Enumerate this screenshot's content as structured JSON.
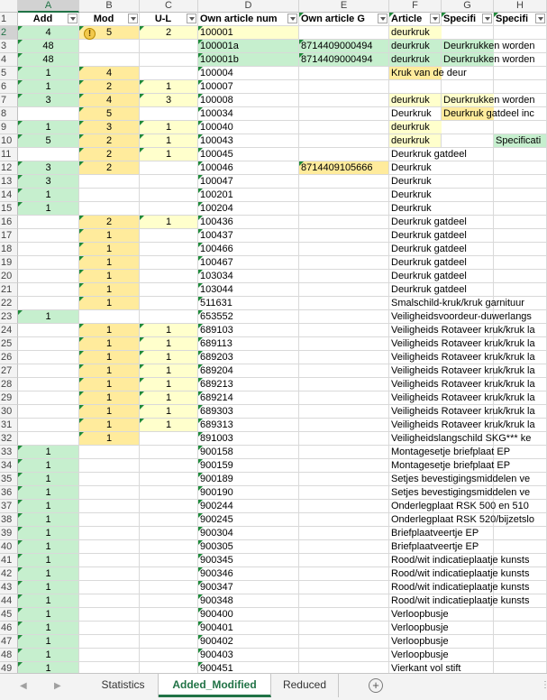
{
  "columns": [
    {
      "letter": "A",
      "header": "Add"
    },
    {
      "letter": "B",
      "header": "Mod"
    },
    {
      "letter": "C",
      "header": "U-L"
    },
    {
      "letter": "D",
      "header": "Own article num"
    },
    {
      "letter": "E",
      "header": "Own article G"
    },
    {
      "letter": "F",
      "header": "Article"
    },
    {
      "letter": "G",
      "header": "Specifi"
    },
    {
      "letter": "H",
      "header": "Specifi"
    }
  ],
  "rows": [
    {
      "n": "2",
      "A": "4",
      "B": "5",
      "C": "2",
      "D": "100001",
      "E": "",
      "F": "deurkruk",
      "G": "",
      "H": ""
    },
    {
      "n": "3",
      "A": "48",
      "B": "",
      "C": "",
      "D": "100001a",
      "E": "8714409000494",
      "F": "deurkruk",
      "G": "Deurkrukken worden",
      "H": ""
    },
    {
      "n": "4",
      "A": "48",
      "B": "",
      "C": "",
      "D": "100001b",
      "E": "8714409000494",
      "F": "deurkruk",
      "G": "Deurkrukken worden",
      "H": ""
    },
    {
      "n": "5",
      "A": "1",
      "B": "4",
      "C": "",
      "D": "100004",
      "E": "",
      "F": "Kruk van de deur",
      "G": "",
      "H": ""
    },
    {
      "n": "6",
      "A": "1",
      "B": "2",
      "C": "1",
      "D": "100007",
      "E": "",
      "F": "",
      "G": "",
      "H": ""
    },
    {
      "n": "7",
      "A": "3",
      "B": "4",
      "C": "3",
      "D": "100008",
      "E": "",
      "F": "deurkruk",
      "G": "Deurkrukken worden",
      "H": ""
    },
    {
      "n": "8",
      "A": "",
      "B": "5",
      "C": "",
      "D": "100034",
      "E": "",
      "F": "Deurkruk",
      "G": "Deurkruk gatdeel inc",
      "H": ""
    },
    {
      "n": "9",
      "A": "1",
      "B": "3",
      "C": "1",
      "D": "100040",
      "E": "",
      "F": "deurkruk",
      "G": "",
      "H": ""
    },
    {
      "n": "10",
      "A": "5",
      "B": "2",
      "C": "1",
      "D": "100043",
      "E": "",
      "F": "deurkruk",
      "G": "",
      "H": "Specificati"
    },
    {
      "n": "11",
      "A": "",
      "B": "2",
      "C": "1",
      "D": "100045",
      "E": "",
      "F": "Deurkruk gatdeel",
      "G": "",
      "H": ""
    },
    {
      "n": "12",
      "A": "3",
      "B": "2",
      "C": "",
      "D": "100046",
      "E": "8714409105666",
      "F": "Deurkruk",
      "G": "",
      "H": ""
    },
    {
      "n": "13",
      "A": "3",
      "B": "",
      "C": "",
      "D": "100047",
      "E": "",
      "F": "Deurkruk",
      "G": "",
      "H": ""
    },
    {
      "n": "14",
      "A": "1",
      "B": "",
      "C": "",
      "D": "100201",
      "E": "",
      "F": "Deurkruk",
      "G": "",
      "H": ""
    },
    {
      "n": "15",
      "A": "1",
      "B": "",
      "C": "",
      "D": "100204",
      "E": "",
      "F": "Deurkruk",
      "G": "",
      "H": ""
    },
    {
      "n": "16",
      "A": "",
      "B": "2",
      "C": "1",
      "D": "100436",
      "E": "",
      "F": "Deurkruk gatdeel",
      "G": "",
      "H": ""
    },
    {
      "n": "17",
      "A": "",
      "B": "1",
      "C": "",
      "D": "100437",
      "E": "",
      "F": "Deurkruk gatdeel",
      "G": "",
      "H": ""
    },
    {
      "n": "18",
      "A": "",
      "B": "1",
      "C": "",
      "D": "100466",
      "E": "",
      "F": "Deurkruk gatdeel",
      "G": "",
      "H": ""
    },
    {
      "n": "19",
      "A": "",
      "B": "1",
      "C": "",
      "D": "100467",
      "E": "",
      "F": "Deurkruk gatdeel",
      "G": "",
      "H": ""
    },
    {
      "n": "20",
      "A": "",
      "B": "1",
      "C": "",
      "D": "103034",
      "E": "",
      "F": "Deurkruk gatdeel",
      "G": "",
      "H": ""
    },
    {
      "n": "21",
      "A": "",
      "B": "1",
      "C": "",
      "D": "103044",
      "E": "",
      "F": "Deurkruk gatdeel",
      "G": "",
      "H": ""
    },
    {
      "n": "22",
      "A": "",
      "B": "1",
      "C": "",
      "D": "511631",
      "E": "",
      "F": "Smalschild-kruk/kruk garnituur",
      "G": "",
      "H": ""
    },
    {
      "n": "23",
      "A": "1",
      "B": "",
      "C": "",
      "D": "653552",
      "E": "",
      "F": "Veiligheidsvoordeur-duwerlangs",
      "G": "",
      "H": ""
    },
    {
      "n": "24",
      "A": "",
      "B": "1",
      "C": "1",
      "D": "689103",
      "E": "",
      "F": "Veiligheids Rotaveer kruk/kruk la",
      "G": "",
      "H": ""
    },
    {
      "n": "25",
      "A": "",
      "B": "1",
      "C": "1",
      "D": "689113",
      "E": "",
      "F": "Veiligheids Rotaveer kruk/kruk la",
      "G": "",
      "H": ""
    },
    {
      "n": "26",
      "A": "",
      "B": "1",
      "C": "1",
      "D": "689203",
      "E": "",
      "F": "Veiligheids Rotaveer kruk/kruk la",
      "G": "",
      "H": ""
    },
    {
      "n": "27",
      "A": "",
      "B": "1",
      "C": "1",
      "D": "689204",
      "E": "",
      "F": "Veiligheids Rotaveer kruk/kruk la",
      "G": "",
      "H": ""
    },
    {
      "n": "28",
      "A": "",
      "B": "1",
      "C": "1",
      "D": "689213",
      "E": "",
      "F": "Veiligheids Rotaveer kruk/kruk la",
      "G": "",
      "H": ""
    },
    {
      "n": "29",
      "A": "",
      "B": "1",
      "C": "1",
      "D": "689214",
      "E": "",
      "F": "Veiligheids Rotaveer kruk/kruk la",
      "G": "",
      "H": ""
    },
    {
      "n": "30",
      "A": "",
      "B": "1",
      "C": "1",
      "D": "689303",
      "E": "",
      "F": "Veiligheids Rotaveer kruk/kruk la",
      "G": "",
      "H": ""
    },
    {
      "n": "31",
      "A": "",
      "B": "1",
      "C": "1",
      "D": "689313",
      "E": "",
      "F": "Veiligheids Rotaveer kruk/kruk la",
      "G": "",
      "H": ""
    },
    {
      "n": "32",
      "A": "",
      "B": "1",
      "C": "",
      "D": "891003",
      "E": "",
      "F": "Veiligheidslangschild SKG*** ke",
      "G": "",
      "H": ""
    },
    {
      "n": "33",
      "A": "1",
      "B": "",
      "C": "",
      "D": "900158",
      "E": "",
      "F": "Montagesetje briefplaat EP",
      "G": "",
      "H": ""
    },
    {
      "n": "34",
      "A": "1",
      "B": "",
      "C": "",
      "D": "900159",
      "E": "",
      "F": "Montagesetje briefplaat EP",
      "G": "",
      "H": ""
    },
    {
      "n": "35",
      "A": "1",
      "B": "",
      "C": "",
      "D": "900189",
      "E": "",
      "F": "Setjes bevestigingsmiddelen ve",
      "G": "",
      "H": ""
    },
    {
      "n": "36",
      "A": "1",
      "B": "",
      "C": "",
      "D": "900190",
      "E": "",
      "F": "Setjes bevestigingsmiddelen ve",
      "G": "",
      "H": ""
    },
    {
      "n": "37",
      "A": "1",
      "B": "",
      "C": "",
      "D": "900244",
      "E": "",
      "F": "Onderlegplaat RSK 500 en 510",
      "G": "",
      "H": ""
    },
    {
      "n": "38",
      "A": "1",
      "B": "",
      "C": "",
      "D": "900245",
      "E": "",
      "F": "Onderlegplaat RSK 520/bijzetslo",
      "G": "",
      "H": ""
    },
    {
      "n": "39",
      "A": "1",
      "B": "",
      "C": "",
      "D": "900304",
      "E": "",
      "F": "Briefplaatveertje EP",
      "G": "",
      "H": ""
    },
    {
      "n": "40",
      "A": "1",
      "B": "",
      "C": "",
      "D": "900305",
      "E": "",
      "F": "Briefplaatveertje EP",
      "G": "",
      "H": ""
    },
    {
      "n": "41",
      "A": "1",
      "B": "",
      "C": "",
      "D": "900345",
      "E": "",
      "F": "Rood/wit indicatieplaatje kunsts",
      "G": "",
      "H": ""
    },
    {
      "n": "42",
      "A": "1",
      "B": "",
      "C": "",
      "D": "900346",
      "E": "",
      "F": "Rood/wit indicatieplaatje kunsts",
      "G": "",
      "H": ""
    },
    {
      "n": "43",
      "A": "1",
      "B": "",
      "C": "",
      "D": "900347",
      "E": "",
      "F": "Rood/wit indicatieplaatje kunsts",
      "G": "",
      "H": ""
    },
    {
      "n": "44",
      "A": "1",
      "B": "",
      "C": "",
      "D": "900348",
      "E": "",
      "F": "Rood/wit indicatieplaatje kunsts",
      "G": "",
      "H": ""
    },
    {
      "n": "45",
      "A": "1",
      "B": "",
      "C": "",
      "D": "900400",
      "E": "",
      "F": "Verloopbusje",
      "G": "",
      "H": ""
    },
    {
      "n": "46",
      "A": "1",
      "B": "",
      "C": "",
      "D": "900401",
      "E": "",
      "F": "Verloopbusje",
      "G": "",
      "H": ""
    },
    {
      "n": "47",
      "A": "1",
      "B": "",
      "C": "",
      "D": "900402",
      "E": "",
      "F": "Verloopbusje",
      "G": "",
      "H": ""
    },
    {
      "n": "48",
      "A": "1",
      "B": "",
      "C": "",
      "D": "900403",
      "E": "",
      "F": "Verloopbusje",
      "G": "",
      "H": ""
    },
    {
      "n": "49",
      "A": "1",
      "B": "",
      "C": "",
      "D": "900451",
      "E": "",
      "F": "Vierkant vol stift",
      "G": "",
      "H": ""
    }
  ],
  "header_row_number": "1",
  "warning_icon": "!",
  "tabs": [
    {
      "label": "Statistics",
      "active": false
    },
    {
      "label": "Added_Modified",
      "active": true
    },
    {
      "label": "Reduced",
      "active": false
    }
  ],
  "add_sheet_label": "+",
  "colors": {
    "green": "#c6efce",
    "yellow": "#ffeb9c",
    "lightyellow": "#ffffcc",
    "accent": "#217346"
  }
}
